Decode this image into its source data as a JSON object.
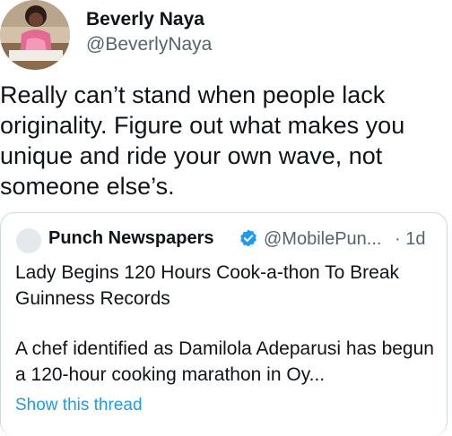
{
  "author": {
    "name": "Beverly Naya",
    "handle": "@BeverlyNaya"
  },
  "tweet": {
    "text": "Really can’t stand when people lack originality. Figure out what makes you unique and ride your own wave, not someone else’s."
  },
  "quote": {
    "name": "Punch Newspapers",
    "handle": "@MobilePun...",
    "separator": "·",
    "time": "1d",
    "headline": "Lady Begins 120 Hours Cook-a-thon To Break Guinness Records",
    "body": "A chef identified as Damilola Adeparusi has begun a 120-hour cooking marathon in Oy...",
    "show_thread": "Show this thread",
    "verified_color": "#1d9bf0"
  },
  "colors": {
    "link": "#1d9bf0",
    "secondary_text": "#536471",
    "border": "#cfd9de"
  }
}
